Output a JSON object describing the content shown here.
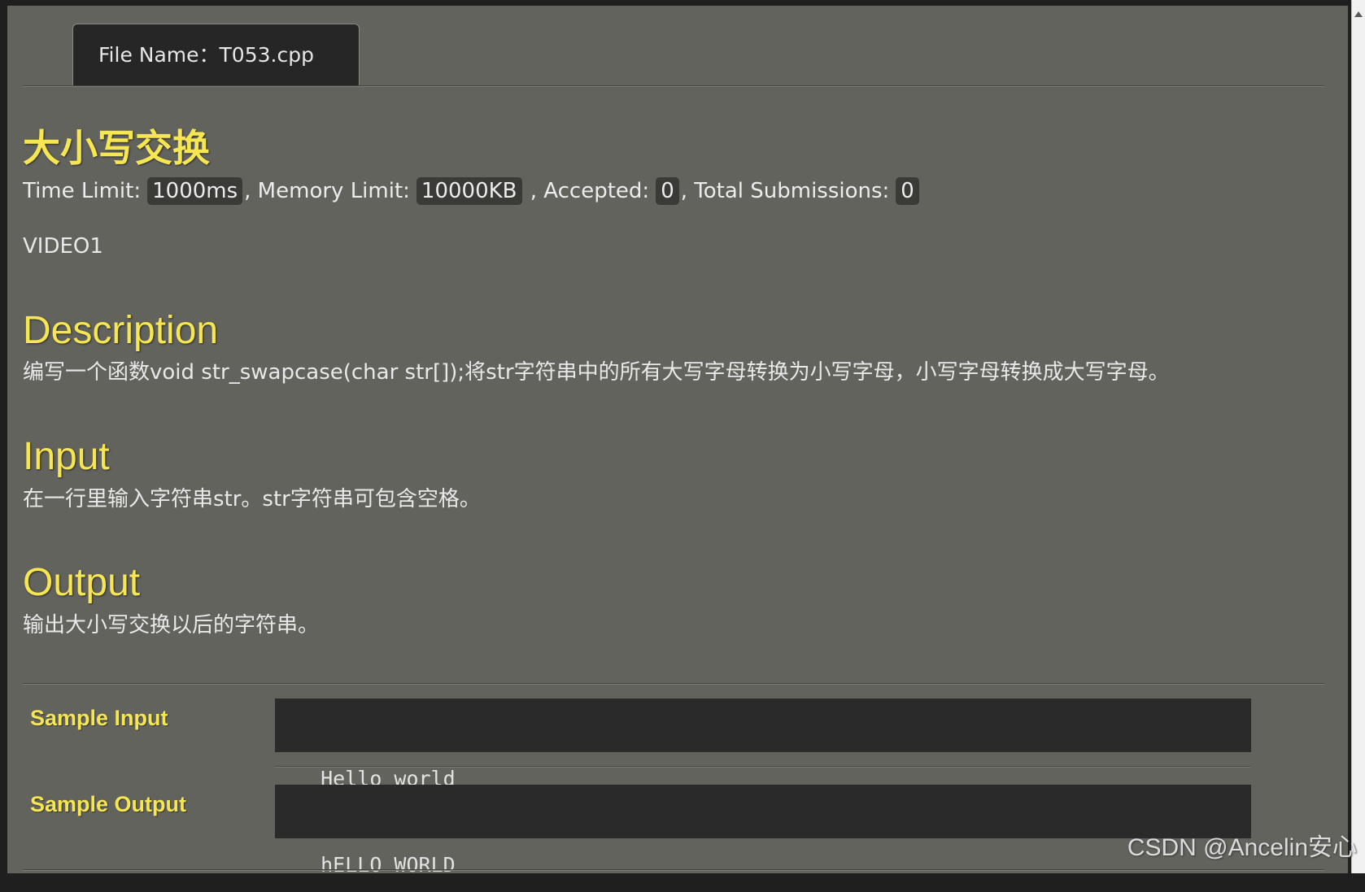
{
  "tab": {
    "file_name": "File Name：T053.cpp"
  },
  "problem": {
    "title": "大小写交换",
    "time_limit_label": "Time Limit:",
    "time_limit": "1000ms",
    "memory_limit_label": ", Memory Limit:",
    "memory_limit": "10000KB",
    "accepted_label": " , Accepted:",
    "accepted": "0",
    "total_submissions_label": ", Total Submissions:",
    "total_submissions": "0",
    "source": "VIDEO1"
  },
  "sections": {
    "description": {
      "heading": "Description",
      "text": "编写一个函数void str_swapcase(char str[]);将str字符串中的所有大写字母转换为小写字母，小写字母转换成大写字母。"
    },
    "input": {
      "heading": "Input",
      "text": "在一行里输入字符串str。str字符串可包含空格。"
    },
    "output": {
      "heading": "Output",
      "text": "输出大小写交换以后的字符串。"
    }
  },
  "samples": {
    "input_label": "Sample Input",
    "input_value": "Hello world",
    "output_label": "Sample Output",
    "output_value": "hELLO WORLD"
  },
  "watermark": "CSDN @Ancelin安心",
  "icons": {
    "scroll_up": "scroll-up-arrow-icon"
  },
  "colors": {
    "heading_yellow": "#f6e652",
    "panel_bg": "#63635e",
    "code_bg": "#2a2a2a",
    "tab_bg": "#262626",
    "badge_bg": "#3a3a37"
  }
}
